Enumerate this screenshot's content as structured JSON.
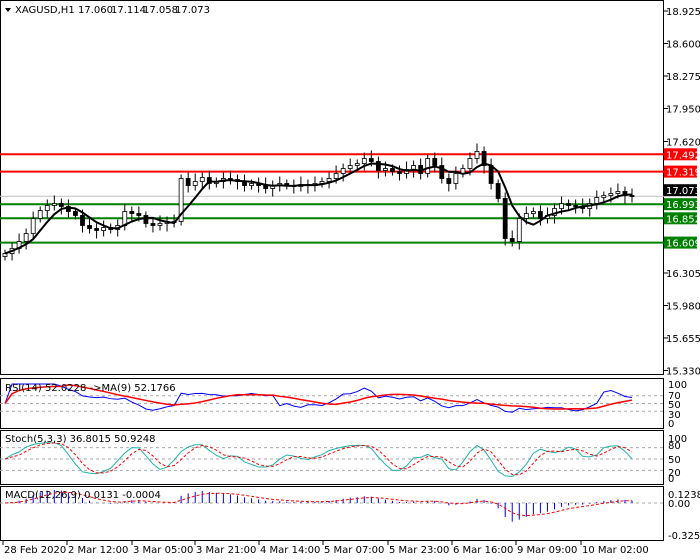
{
  "header": {
    "symbol": "XAGUSD,H1",
    "open": "17.060",
    "high": "17.114",
    "low": "17.058",
    "close": "17.073"
  },
  "price_axis": [
    "18.925",
    "18.600",
    "18.275",
    "17.950",
    "17.620",
    "16.305",
    "15.980",
    "15.655",
    "15.330"
  ],
  "levels": [
    {
      "value": 17.492,
      "label": "17.492",
      "color": "#ff0000"
    },
    {
      "value": 17.319,
      "label": "17.319",
      "color": "#ff0000"
    },
    {
      "value": 16.993,
      "label": "16.993",
      "color": "#008000"
    },
    {
      "value": 16.852,
      "label": "16.852",
      "color": "#008000"
    },
    {
      "value": 16.609,
      "label": "16.609",
      "color": "#008000"
    }
  ],
  "current_price": {
    "value": 17.073,
    "label": "17.073"
  },
  "rsi": {
    "label": "RSI(14) 52.0228  ->MA(9) 52.1766",
    "axis": [
      "100",
      "70",
      "50",
      "30",
      "0"
    ]
  },
  "stoch": {
    "label": "Stoch(5,3,3) 36.8015 50.9248",
    "axis": [
      "100",
      "80",
      "50",
      "20",
      "0"
    ]
  },
  "macd": {
    "label": "MACD(12,26,9) 0.0131 -0.0004",
    "axis": [
      "0.1238",
      "0.00",
      "-0.3253"
    ]
  },
  "time_axis": [
    "28 Feb 2020",
    "2 Mar 12:00",
    "3 Mar 05:00",
    "3 Mar 21:00",
    "4 Mar 14:00",
    "5 Mar 07:00",
    "5 Mar 23:00",
    "6 Mar 16:00",
    "9 Mar 09:00",
    "10 Mar 02:00"
  ],
  "chart_data": {
    "type": "candlestick",
    "closes": [
      16.5,
      16.55,
      16.62,
      16.7,
      16.85,
      16.93,
      16.98,
      17.0,
      16.97,
      16.92,
      16.88,
      16.78,
      16.75,
      16.73,
      16.76,
      16.74,
      16.78,
      16.92,
      16.9,
      16.88,
      16.8,
      16.78,
      16.8,
      16.82,
      16.82,
      17.25,
      17.18,
      17.22,
      17.26,
      17.2,
      17.22,
      17.25,
      17.24,
      17.22,
      17.18,
      17.2,
      17.18,
      17.15,
      17.18,
      17.2,
      17.18,
      17.17,
      17.19,
      17.18,
      17.2,
      17.22,
      17.25,
      17.3,
      17.35,
      17.38,
      17.4,
      17.45,
      17.42,
      17.33,
      17.35,
      17.32,
      17.3,
      17.34,
      17.38,
      17.3,
      17.45,
      17.38,
      17.25,
      17.2,
      17.3,
      17.35,
      17.45,
      17.52,
      17.38,
      17.2,
      17.05,
      16.65,
      16.62,
      16.85,
      16.9,
      16.92,
      16.85,
      16.88,
      16.95,
      17.0,
      16.98,
      16.97,
      16.95,
      17.0,
      17.06,
      17.08,
      17.1,
      17.12,
      17.08,
      17.07
    ],
    "price_range": [
      15.33,
      18.925
    ]
  }
}
